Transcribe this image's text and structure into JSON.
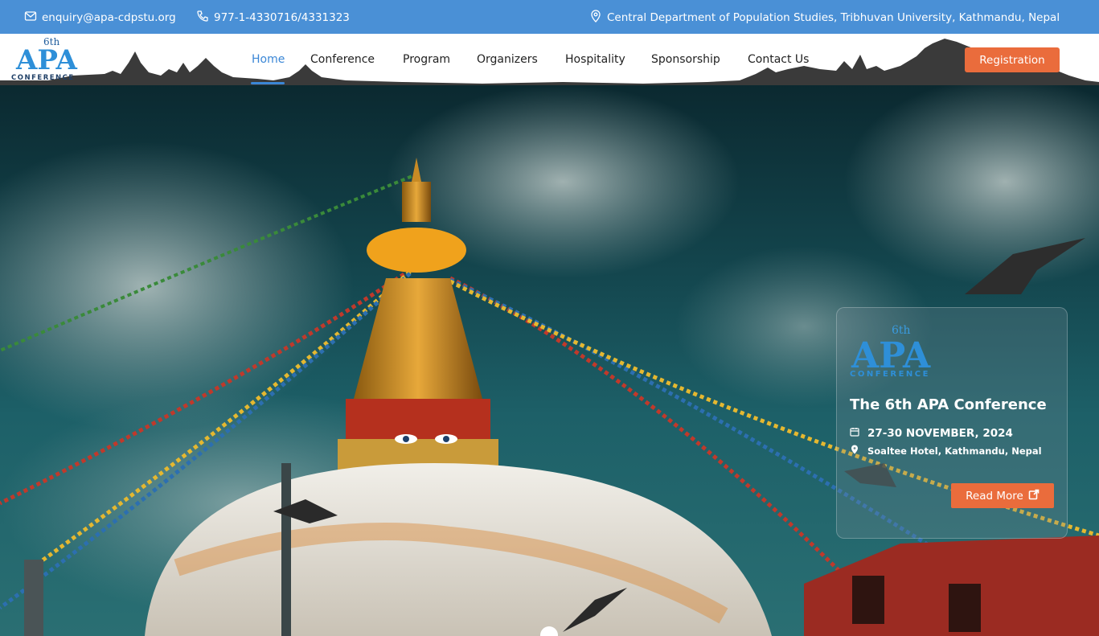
{
  "topbar": {
    "email": "enquiry@apa-cdpstu.org",
    "phone": "977-1-4330716/4331323",
    "address": "Central Department of Population Studies, Tribhuvan University, Kathmandu, Nepal"
  },
  "logo": {
    "superscript": "6th",
    "main": "APA",
    "sub": "CONFERENCE"
  },
  "nav": {
    "items": [
      "Home",
      "Conference",
      "Program",
      "Organizers",
      "Hospitality",
      "Sponsorship",
      "Contact Us"
    ],
    "active": "Home",
    "register_label": "Registration"
  },
  "hero": {
    "card": {
      "title": "The 6th APA Conference",
      "dates": "27-30 NOVEMBER, 2024",
      "venue": "Soaltee Hotel, Kathmandu, Nepal",
      "button_label": "Read More"
    }
  },
  "colors": {
    "topbar": "#4a90d6",
    "accent": "#ea6c3c",
    "active_nav": "#3b87d6"
  }
}
